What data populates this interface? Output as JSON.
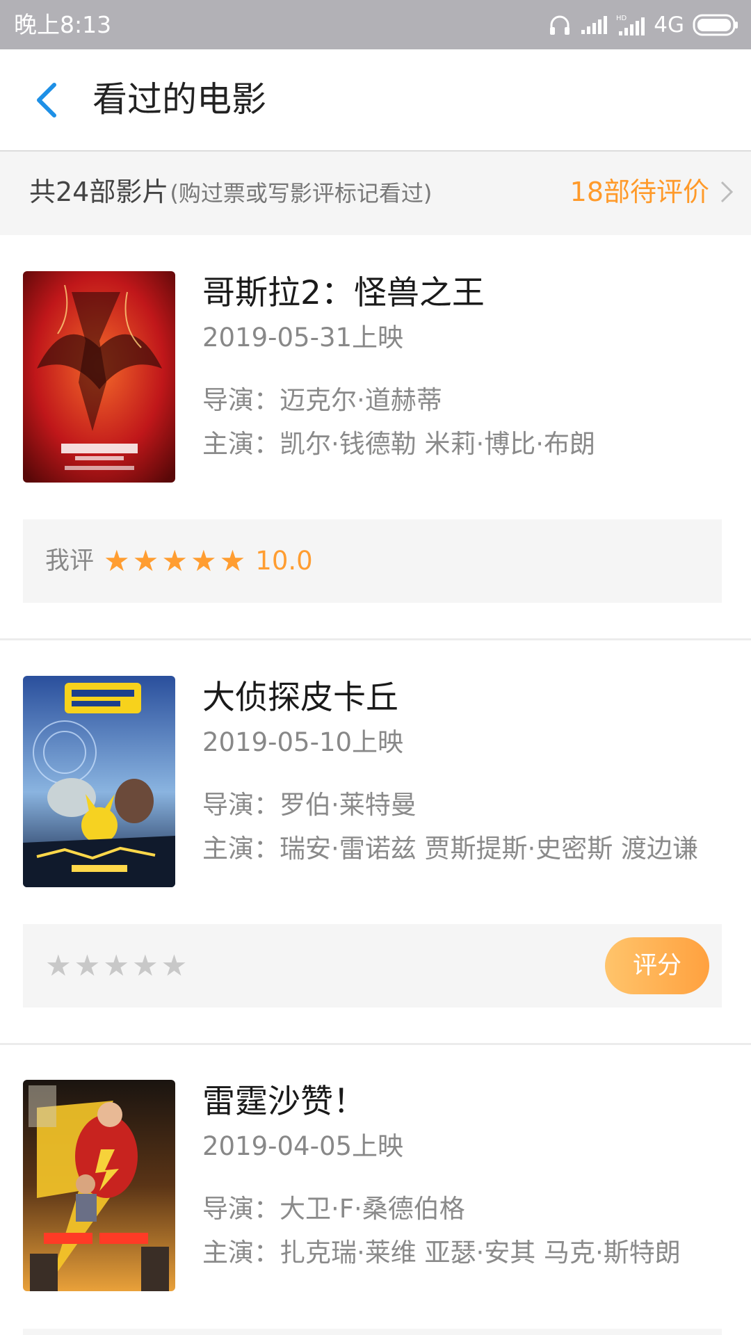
{
  "status_bar": {
    "time": "晚上8:13",
    "network": "4G",
    "icons": [
      "headphones-icon",
      "signal-icon",
      "hd-signal-icon",
      "battery-icon"
    ]
  },
  "header": {
    "title": "看过的电影",
    "back_icon": "back-arrow-icon"
  },
  "summary": {
    "count": "共24部影片",
    "note": "(购过票或写影评标记看过)",
    "pending": "18部待评价",
    "accent_color": "#ff9a2a"
  },
  "movies": [
    {
      "title": "哥斯拉2：怪兽之王",
      "date": "2019-05-31上映",
      "director_label": "导演：",
      "director": "迈克尔·道赫蒂",
      "cast_label": "主演：",
      "cast": "凯尔·钱德勒 米莉·博比·布朗",
      "rating_label": "我评",
      "stars_filled": 5,
      "score": "10.0",
      "rated": true
    },
    {
      "title": "大侦探皮卡丘",
      "date": "2019-05-10上映",
      "director_label": "导演：",
      "director": "罗伯·莱特曼",
      "cast_label": "主演：",
      "cast": "瑞安·雷诺兹 贾斯提斯·史密斯 渡边谦",
      "stars_filled": 0,
      "rate_button": "评分",
      "rated": false
    },
    {
      "title": "雷霆沙赞！",
      "date": "2019-04-05上映",
      "director_label": "导演：",
      "director": "大卫·F·桑德伯格",
      "cast_label": "主演：",
      "cast": "扎克瑞·莱维 亚瑟·安其 马克·斯特朗"
    }
  ],
  "colors": {
    "status_bar": "#b2b1b6",
    "accent": "#ff9d31",
    "back_arrow": "#1e90e6"
  }
}
